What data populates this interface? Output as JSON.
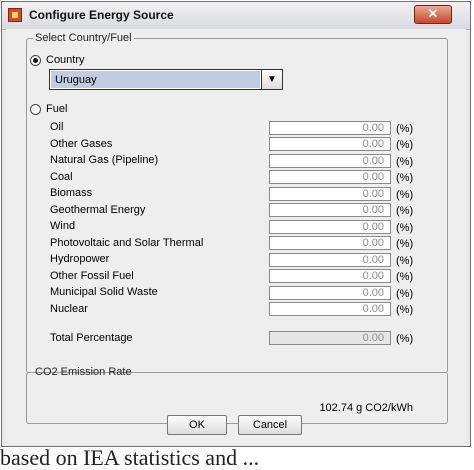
{
  "window": {
    "title": "Configure Energy Source",
    "close_glyph": "✕"
  },
  "select_group": {
    "legend": "Select Country/Fuel",
    "country_label": "Country",
    "country_value": "Uruguay",
    "fuel_label": "Fuel"
  },
  "fuels": [
    {
      "label": "Oil",
      "value": "0.00",
      "unit": "(%)"
    },
    {
      "label": "Other Gases",
      "value": "0.00",
      "unit": "(%)"
    },
    {
      "label": "Natural Gas (Pipeline)",
      "value": "0.00",
      "unit": "(%)"
    },
    {
      "label": "Coal",
      "value": "0.00",
      "unit": "(%)"
    },
    {
      "label": "Biomass",
      "value": "0.00",
      "unit": "(%)"
    },
    {
      "label": "Geothermal Energy",
      "value": "0.00",
      "unit": "(%)"
    },
    {
      "label": "Wind",
      "value": "0.00",
      "unit": "(%)"
    },
    {
      "label": "Photovoltaic and Solar Thermal",
      "value": "0.00",
      "unit": "(%)"
    },
    {
      "label": "Hydropower",
      "value": "0.00",
      "unit": "(%)"
    },
    {
      "label": "Other Fossil Fuel",
      "value": "0.00",
      "unit": "(%)"
    },
    {
      "label": "Municipal Solid Waste",
      "value": "0.00",
      "unit": "(%)"
    },
    {
      "label": "Nuclear",
      "value": "0.00",
      "unit": "(%)"
    }
  ],
  "total": {
    "label": "Total Percentage",
    "value": "0.00",
    "unit": "(%)"
  },
  "co2_group": {
    "legend": "CO2 Emission Rate",
    "value": "102.74 g CO2/kWh"
  },
  "buttons": {
    "ok": "OK",
    "cancel": "Cancel"
  },
  "caption": "based on IEA statistics and ..."
}
